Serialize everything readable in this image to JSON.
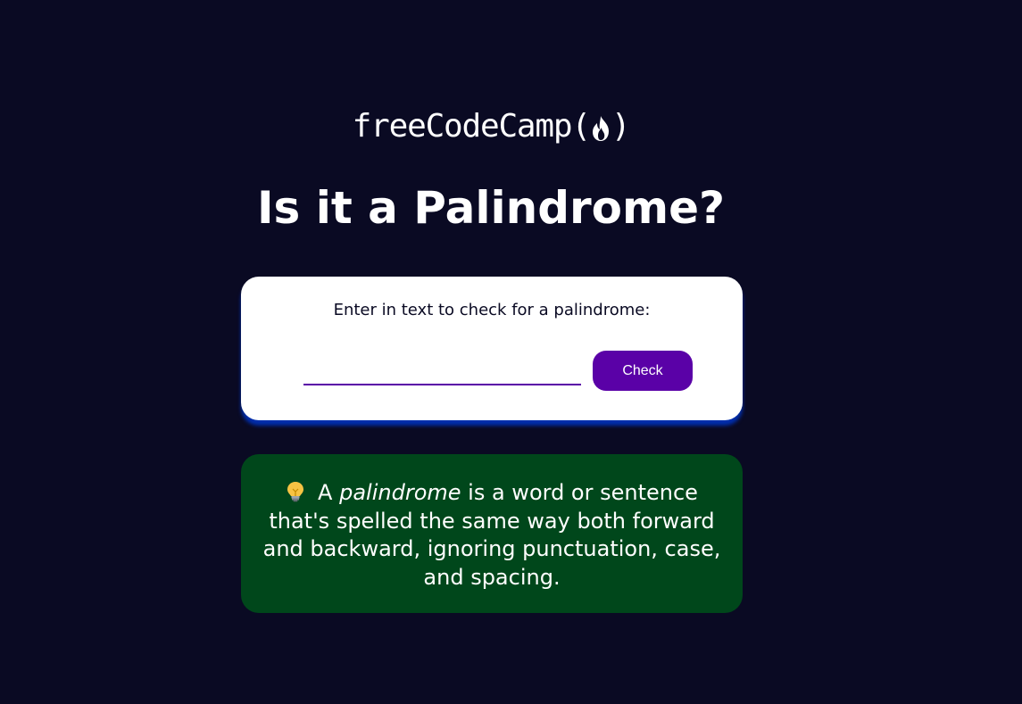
{
  "header": {
    "logo_text": "freeCodeCamp(",
    "logo_close": ")",
    "logo_icon": "fire-icon",
    "title": "Is it a Palindrome?"
  },
  "input_card": {
    "label": "Enter in text to check for a palindrome:",
    "input_value": "",
    "input_placeholder": "",
    "button_label": "Check"
  },
  "info_card": {
    "icon": "lightbulb-icon",
    "article": "A",
    "term": "palindrome",
    "definition": "is a word or sentence that's spelled the same way both forward and backward, ignoring punctuation, case, and spacing."
  },
  "colors": {
    "background": "#0a0a23",
    "card": "#ffffff",
    "card_shadow": "#002ead",
    "button": "#5a01a7",
    "info_card": "#00471b"
  }
}
